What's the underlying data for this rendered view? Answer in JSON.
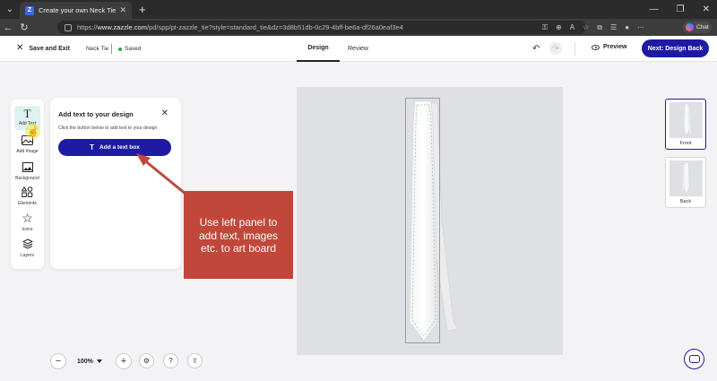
{
  "browser": {
    "tab_title": "Create your own Neck Tie | Zazzle",
    "favicon_letter": "Z",
    "url_prefix": "https://",
    "url_domain": "www.zazzle.com",
    "url_path": "/pd/spp/pt-zazzle_tie?style=standard_tie&dz=3d8b51db-0c29-4bff-be6a-df26a0eaf3e4",
    "chat_label": "Chat"
  },
  "header": {
    "save_exit": "Save and Exit",
    "product_name": "Neck Tie",
    "saved_status": "Saved",
    "tabs": [
      "Design",
      "Review"
    ],
    "preview": "Preview",
    "next_button": "Next: Design Back"
  },
  "toolbar": {
    "items": [
      {
        "label": "Add Text",
        "icon": "text-icon"
      },
      {
        "label": "Add Image",
        "icon": "image-icon"
      },
      {
        "label": "Background",
        "icon": "background-icon"
      },
      {
        "label": "Elements",
        "icon": "elements-icon"
      },
      {
        "label": "Icons",
        "icon": "star-icon"
      },
      {
        "label": "Layers",
        "icon": "layers-icon"
      }
    ]
  },
  "text_panel": {
    "title": "Add text to your design",
    "description": "Click the button below to add text to your design",
    "button_label": "Add a text box"
  },
  "callout": {
    "text": "Use left panel to add text, images etc. to art board",
    "color": "#c0473a"
  },
  "views": [
    {
      "label": "Front"
    },
    {
      "label": "Back"
    }
  ],
  "zoom": {
    "level": "100%"
  },
  "colors": {
    "brand": "#1e1aa3",
    "canvas": "#dfe0e3",
    "saved_dot": "#2aa24b"
  }
}
